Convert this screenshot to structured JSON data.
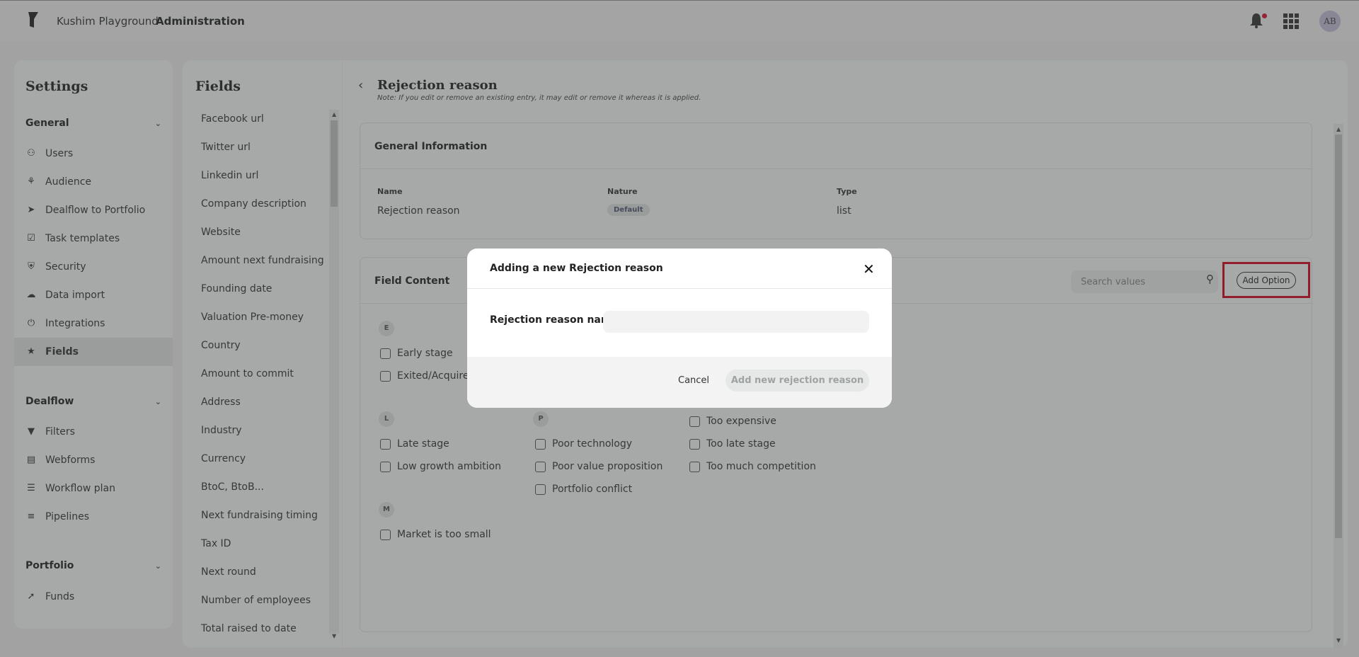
{
  "topbar": {
    "org_name": "Kushim Playground",
    "section": "Administration",
    "avatar_initials": "AB",
    "notification_dot_color": "#dd1133"
  },
  "settings": {
    "title": "Settings",
    "groups": [
      {
        "label": "General",
        "items": [
          {
            "label": "Users",
            "icon": "users-icon"
          },
          {
            "label": "Audience",
            "icon": "audience-icon"
          },
          {
            "label": "Dealflow to Portfolio",
            "icon": "send-icon"
          },
          {
            "label": "Task templates",
            "icon": "checkbox-icon"
          },
          {
            "label": "Security",
            "icon": "shield-icon"
          },
          {
            "label": "Data import",
            "icon": "cloud-upload-icon"
          },
          {
            "label": "Integrations",
            "icon": "plug-icon"
          },
          {
            "label": "Fields",
            "icon": "star-icon",
            "active": true
          }
        ]
      },
      {
        "label": "Dealflow",
        "items": [
          {
            "label": "Filters",
            "icon": "filter-icon"
          },
          {
            "label": "Webforms",
            "icon": "clipboard-icon"
          },
          {
            "label": "Workflow plan",
            "icon": "layers-icon"
          },
          {
            "label": "Pipelines",
            "icon": "list-icon"
          }
        ]
      },
      {
        "label": "Portfolio",
        "items": [
          {
            "label": "Funds",
            "icon": "rocket-icon"
          }
        ]
      }
    ]
  },
  "fields": {
    "title": "Fields",
    "items": [
      "Facebook url",
      "Twitter url",
      "Linkedin url",
      "Company description",
      "Website",
      "Amount next fundraising",
      "Founding date",
      "Valuation Pre-money",
      "Country",
      "Amount to commit",
      "Address",
      "Industry",
      "Currency",
      "BtoC, BtoB...",
      "Next fundraising timing",
      "Tax ID",
      "Next round",
      "Number of employees",
      "Total raised to date"
    ]
  },
  "main": {
    "title": "Rejection reason",
    "note": "Note: If you edit or remove an existing entry, it may edit or remove it whereas it is applied.",
    "general_info": {
      "heading": "General Information",
      "name_label": "Name",
      "name_value": "Rejection reason",
      "nature_label": "Nature",
      "nature_value": "Default",
      "type_label": "Type",
      "type_value": "list"
    },
    "field_content": {
      "heading": "Field Content",
      "search_placeholder": "Search values",
      "add_option": "Add Option",
      "letters": [
        "E",
        "L",
        "P",
        "M"
      ],
      "options": {
        "e1": "Early stage",
        "e2": "Exited/Acquired",
        "l1": "Late stage",
        "l2": "Low growth ambition",
        "p1": "Poor technology",
        "p2": "Poor value proposition",
        "p3": "Portfolio conflict",
        "t1": "Too expensive",
        "t2": "Too late stage",
        "t3": "Too much competition",
        "m1": "Market is too small"
      }
    }
  },
  "modal": {
    "title": "Adding a new Rejection reason",
    "field_label": "Rejection reason name",
    "field_value": "",
    "cancel": "Cancel",
    "submit": "Add new rejection reason"
  }
}
